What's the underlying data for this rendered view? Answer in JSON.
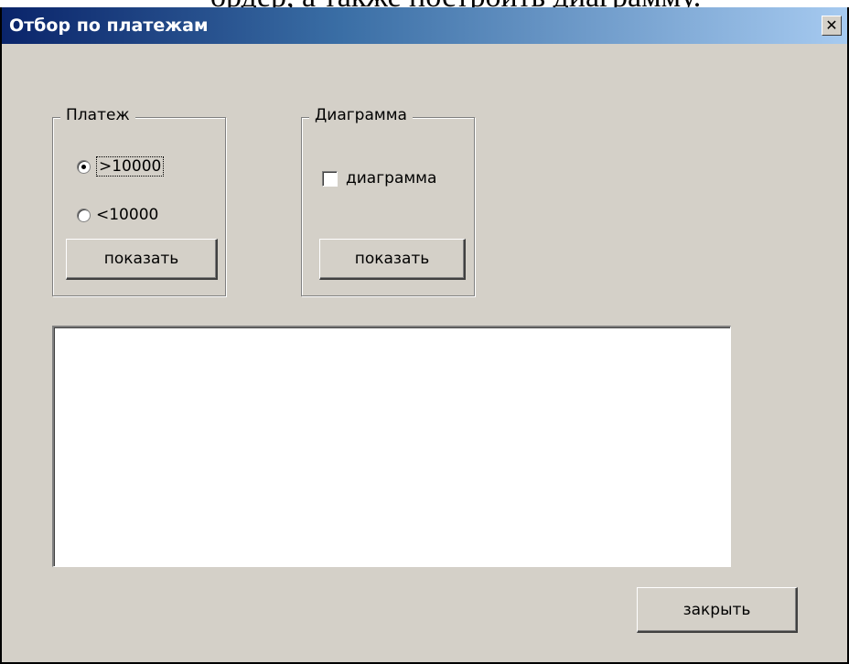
{
  "document_fragment": "ордер, а также построить диаграмму.",
  "window": {
    "title": "Отбор по платежам",
    "close_symbol": "✕"
  },
  "payment_group": {
    "legend": "Платеж",
    "options": [
      {
        "label": ">10000",
        "selected": true
      },
      {
        "label": "<10000",
        "selected": false
      }
    ],
    "show_button": "показать"
  },
  "chart_group": {
    "legend": "Диаграмма",
    "checkbox_label": "диаграмма",
    "checkbox_checked": false,
    "show_button": "показать"
  },
  "results_list": {
    "items": []
  },
  "close_button": "закрыть"
}
